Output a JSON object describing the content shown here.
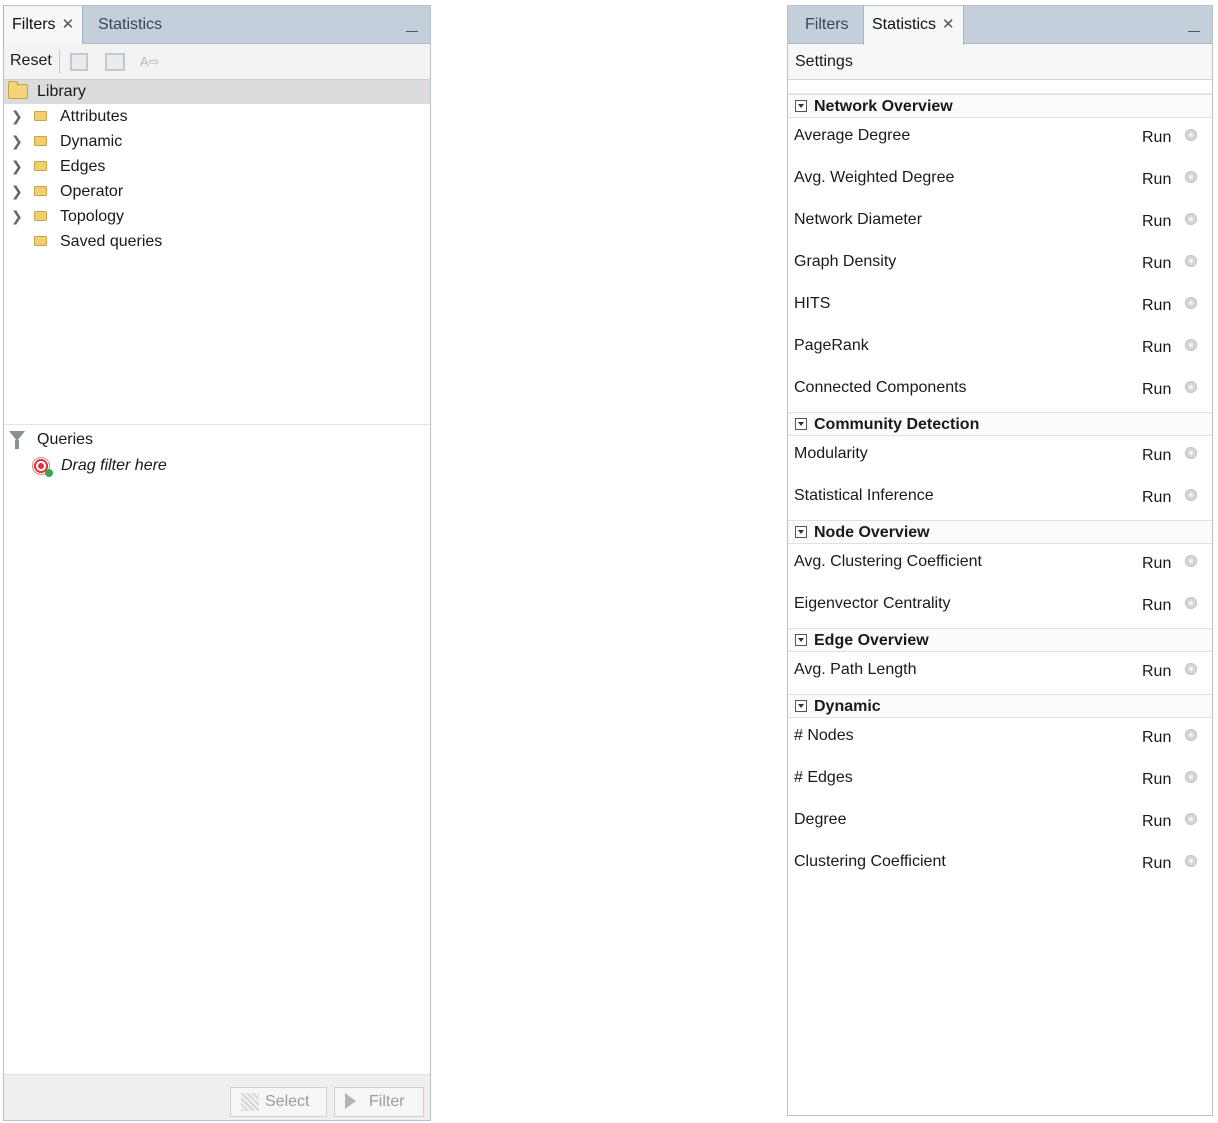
{
  "filters_panel": {
    "tabs": [
      {
        "label": "Filters",
        "active": true,
        "closable": true
      },
      {
        "label": "Statistics",
        "active": false
      }
    ],
    "toolbar": {
      "reset_label": "Reset",
      "icons": [
        "save-query-icon",
        "export-icon",
        "rename-icon"
      ]
    },
    "library": {
      "root_label": "Library",
      "items": [
        {
          "label": "Attributes",
          "expandable": true
        },
        {
          "label": "Dynamic",
          "expandable": true
        },
        {
          "label": "Edges",
          "expandable": true
        },
        {
          "label": "Operator",
          "expandable": true
        },
        {
          "label": "Topology",
          "expandable": true
        },
        {
          "label": "Saved queries",
          "expandable": false
        }
      ]
    },
    "queries": {
      "label": "Queries",
      "drag_hint": "Drag filter here"
    },
    "buttons": {
      "select_label": "Select",
      "filter_label": "Filter"
    }
  },
  "statistics_panel": {
    "tabs": [
      {
        "label": "Filters",
        "active": false
      },
      {
        "label": "Statistics",
        "active": true,
        "closable": true
      }
    ],
    "settings_label": "Settings",
    "run_label": "Run",
    "sections": [
      {
        "title": "Network Overview",
        "items": [
          "Average Degree",
          "Avg. Weighted Degree",
          "Network Diameter",
          "Graph Density",
          "HITS",
          "PageRank",
          "Connected Components"
        ]
      },
      {
        "title": "Community Detection",
        "items": [
          "Modularity",
          "Statistical Inference"
        ]
      },
      {
        "title": "Node Overview",
        "items": [
          "Avg. Clustering Coefficient",
          "Eigenvector Centrality"
        ]
      },
      {
        "title": "Edge Overview",
        "items": [
          "Avg. Path Length"
        ]
      },
      {
        "title": "Dynamic",
        "items": [
          "# Nodes",
          "# Edges",
          "Degree",
          "Clustering Coefficient"
        ]
      }
    ]
  },
  "colors": {
    "tabbar_bg": "#c4cfdb",
    "folder": "#f3d47c",
    "disabled_text": "#9c9c9c"
  }
}
